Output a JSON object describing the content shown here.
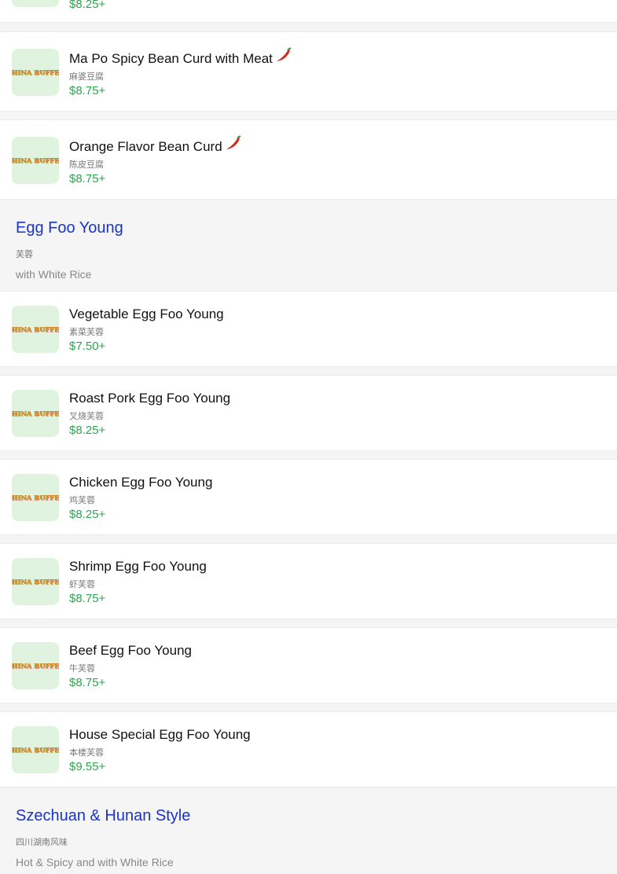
{
  "brand_logo_text": "CHINA BUFFET",
  "colors": {
    "price": "#2ea44f",
    "section_title": "#1a33c8",
    "spicy": "#d8261b"
  },
  "top_partial_item": {
    "price": "$8.25+"
  },
  "items_a": [
    {
      "name": "Ma Po Spicy Bean Curd with Meat",
      "cn": "麻婆豆腐",
      "price": "$8.75+",
      "spicy": true,
      "icon": "chili-pepper-icon"
    },
    {
      "name": "Orange Flavor Bean Curd",
      "cn": "陈皮豆腐",
      "price": "$8.75+",
      "spicy": true,
      "icon": "chili-pepper-icon"
    }
  ],
  "section_egg": {
    "title": "Egg Foo Young",
    "cn": "芙蓉",
    "desc": "with White Rice"
  },
  "items_b": [
    {
      "name": "Vegetable Egg Foo Young",
      "cn": "素菜芙蓉",
      "price": "$7.50+"
    },
    {
      "name": "Roast Pork Egg Foo Young",
      "cn": "叉烧芙蓉",
      "price": "$8.25+"
    },
    {
      "name": "Chicken Egg Foo Young",
      "cn": "鸡芙蓉",
      "price": "$8.25+"
    },
    {
      "name": "Shrimp Egg Foo Young",
      "cn": "虾芙蓉",
      "price": "$8.75+"
    },
    {
      "name": "Beef Egg Foo Young",
      "cn": "牛芙蓉",
      "price": "$8.75+"
    },
    {
      "name": "House Special Egg Foo Young",
      "cn": "本楼芙蓉",
      "price": "$9.55+"
    }
  ],
  "section_szechuan": {
    "title": "Szechuan & Hunan Style",
    "cn": "四川湖南风味",
    "desc": "Hot & Spicy and with White Rice"
  }
}
